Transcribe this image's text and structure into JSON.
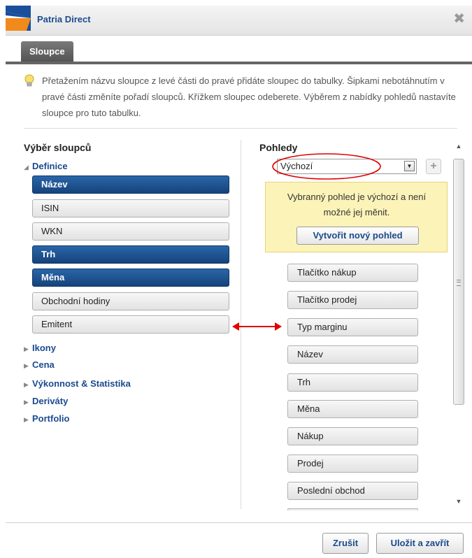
{
  "window": {
    "title": "Patria Direct",
    "close_glyph": "✖"
  },
  "tabs": [
    {
      "label": "Sloupce",
      "active": true
    }
  ],
  "info": {
    "icon": "lightbulb-icon",
    "text": "Přetažením názvu sloupce z levé části do pravé přidáte sloupec do tabulky. Šipkami nebotáhnutím v pravé části změníte pořadí sloupců. Křížkem sloupec odeberete. Výběrem z nabídky pohledů nastavíte sloupce pro tuto tabulku."
  },
  "left_panel": {
    "title": "Výběr sloupců",
    "expanded_group": "Definice",
    "items": [
      {
        "label": "Název",
        "selected": true
      },
      {
        "label": "ISIN",
        "selected": false
      },
      {
        "label": "WKN",
        "selected": false
      },
      {
        "label": "Trh",
        "selected": true
      },
      {
        "label": "Měna",
        "selected": true
      },
      {
        "label": "Obchodní hodiny",
        "selected": false
      },
      {
        "label": "Emitent",
        "selected": false
      }
    ],
    "collapsed_groups": [
      "Ikony",
      "Cena",
      "Výkonnost & Statistika",
      "Deriváty",
      "Portfolio"
    ]
  },
  "right_panel": {
    "title": "Pohledy",
    "view_select": {
      "value": "Výchozí"
    },
    "notice": {
      "text": "Vybranný pohled je výchozí a není možné jej měnit.",
      "button_label": "Vytvořit nový pohled"
    },
    "columns": [
      "Tlačítko nákup",
      "Tlačítko prodej",
      "Typ marginu",
      "Název",
      "Trh",
      "Měna",
      "Nákup",
      "Prodej",
      "Poslední obchod"
    ]
  },
  "annotation_colors": {
    "red": "#e00000"
  },
  "accent_color": "#1b4a8e",
  "footer": {
    "cancel_label": "Zrušit",
    "save_label": "Uložit a zavřít"
  }
}
